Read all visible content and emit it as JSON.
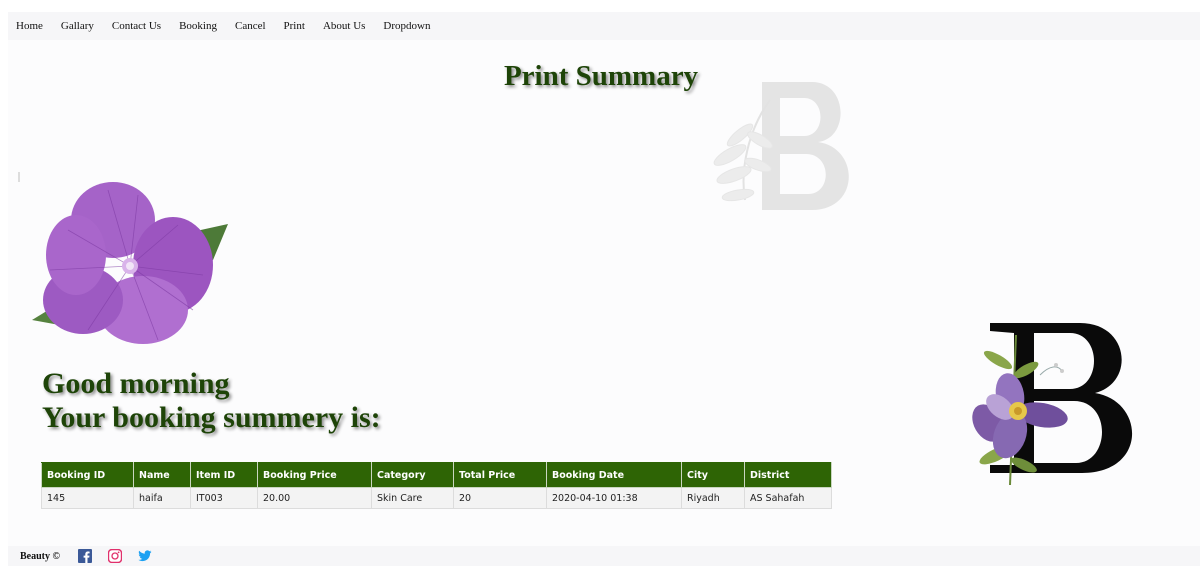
{
  "nav": {
    "items": [
      "Home",
      "Gallary",
      "Contact Us",
      "Booking",
      "Cancel",
      "Print",
      "About Us",
      "Dropdown"
    ]
  },
  "page": {
    "title": "Print Summary",
    "greeting_line1": "Good morning",
    "greeting_line2": "Your booking summery is:"
  },
  "table": {
    "headers": [
      "Booking ID",
      "Name",
      "Item ID",
      "Booking Price",
      "Category",
      "Total Price",
      "Booking Date",
      "City",
      "District"
    ],
    "rows": [
      [
        "145",
        "haifa",
        "IT003",
        "20.00",
        "Skin Care",
        "20",
        "2020-04-10 01:38",
        "Riyadh",
        "AS Sahafah"
      ]
    ]
  },
  "footer": {
    "text": "Beauty ©",
    "social": [
      "facebook-icon",
      "instagram-icon",
      "twitter-icon"
    ]
  },
  "colors": {
    "accent_green": "#2e6405",
    "title_green": "#1e4408"
  }
}
